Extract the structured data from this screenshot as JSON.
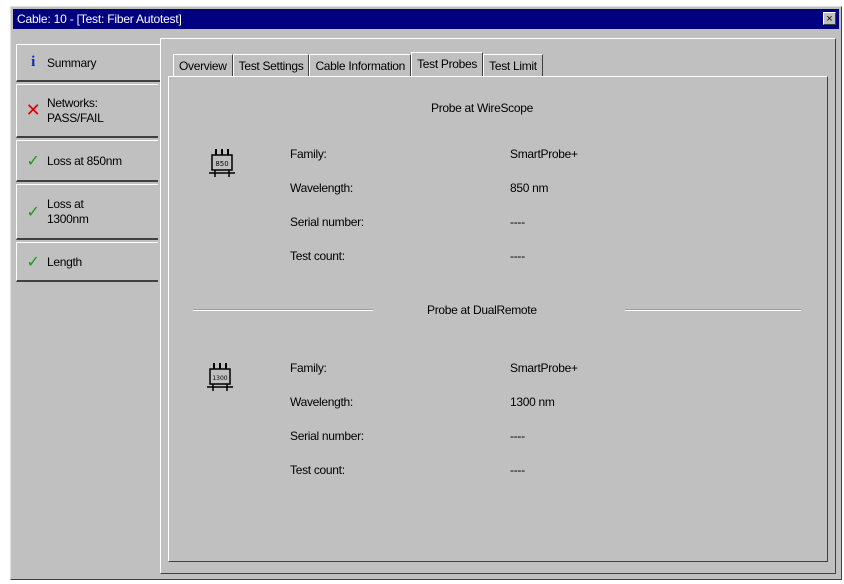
{
  "window": {
    "title": "Cable: 10 - [Test: Fiber Autotest]",
    "close_glyph": "×"
  },
  "sidebar": {
    "items": [
      {
        "label": "Summary",
        "icon": "info-icon"
      },
      {
        "label": "Networks: PASS/FAIL",
        "icon": "fail-x-icon"
      },
      {
        "label": "Loss at 850nm",
        "icon": "pass-check-icon"
      },
      {
        "label": "Loss at 1300nm",
        "icon": "pass-check-icon"
      },
      {
        "label": "Length",
        "icon": "pass-check-icon"
      }
    ]
  },
  "tabs": [
    "Overview",
    "Test Settings",
    "Cable Information",
    "Test Probes",
    "Test Limit"
  ],
  "active_tab": "Test Probes",
  "probes": [
    {
      "heading": "Probe at WireScope",
      "icon_label": "850",
      "rows": [
        {
          "label": "Family:",
          "value": "SmartProbe+"
        },
        {
          "label": "Wavelength:",
          "value": "850 nm"
        },
        {
          "label": "Serial number:",
          "value": "----"
        },
        {
          "label": "Test count:",
          "value": "----"
        }
      ]
    },
    {
      "heading": "Probe at DualRemote",
      "icon_label": "1300",
      "rows": [
        {
          "label": "Family:",
          "value": "SmartProbe+"
        },
        {
          "label": "Wavelength:",
          "value": "1300 nm"
        },
        {
          "label": "Serial number:",
          "value": "----"
        },
        {
          "label": "Test count:",
          "value": "----"
        }
      ]
    }
  ],
  "colors": {
    "titlebar": "#000080",
    "pass": "#1a9a1a",
    "fail": "#e00000",
    "info": "#1028b0"
  }
}
